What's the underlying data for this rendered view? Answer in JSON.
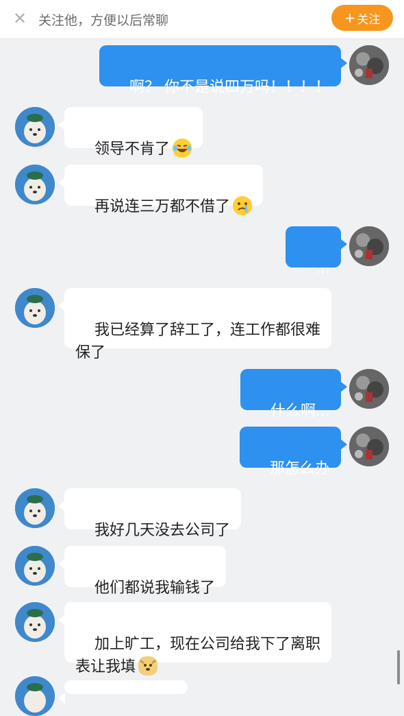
{
  "topbar": {
    "close_icon": "close-icon",
    "hint": "关注他，方便以后常聊",
    "follow_plus": "+",
    "follow_label": "关注",
    "follow_color": "#f7961e"
  },
  "messages": [
    {
      "side": "self",
      "text": "啊？ 你不是说四万吗！！！！"
    },
    {
      "side": "other",
      "text": "领导不肯了",
      "emoji": "laugh-cry-emoji"
    },
    {
      "side": "other",
      "text": "再说连三万都不借了",
      "emoji": "crying-emoji"
    },
    {
      "side": "self",
      "text": "..."
    },
    {
      "side": "other",
      "text": "我已经算了辞工了，连工作都很难\n保了"
    },
    {
      "side": "self",
      "text": "什么啊..."
    },
    {
      "side": "self",
      "text": "那怎么办"
    },
    {
      "side": "other",
      "text": "我好几天没去公司了"
    },
    {
      "side": "other",
      "text": "他们都说我输钱了"
    },
    {
      "side": "other",
      "text": "加上旷工，现在公司给我下了离职\n表让我填",
      "emoji": "dog-emoji"
    }
  ],
  "colors": {
    "self_bubble": "#2e90ef",
    "other_bubble": "#ffffff",
    "background": "#f0f1f3"
  }
}
